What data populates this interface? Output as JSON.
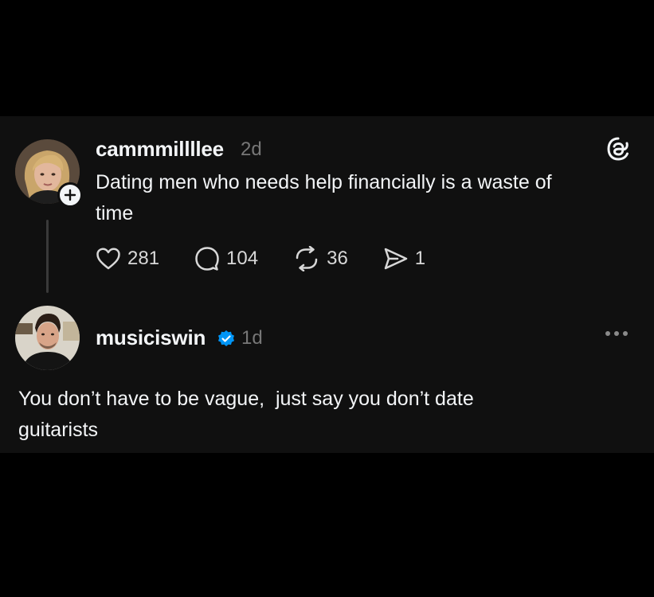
{
  "post": {
    "username": "cammmillllee",
    "time": "2d",
    "text_line1": "Dating men who needs help financially is a waste of",
    "text_line2": "time",
    "likes": "281",
    "comments": "104",
    "reposts": "36",
    "shares": "1"
  },
  "reply": {
    "username": "musiciswin",
    "time": "1d",
    "verified": true,
    "text_line1": "You don’t have to be vague,  just say you don’t date",
    "text_line2": "guitarists"
  },
  "icons": {
    "logo": "threads-logo-icon",
    "like": "heart-icon",
    "comment": "comment-bubble-icon",
    "repost": "repost-icon",
    "share": "send-icon",
    "more": "more-dots-icon",
    "verified": "verified-badge-icon",
    "follow": "plus-icon"
  },
  "colors": {
    "background": "#000000",
    "card": "#101010",
    "text": "#f3f5f7",
    "muted": "#777777",
    "verified": "#0095f6"
  }
}
